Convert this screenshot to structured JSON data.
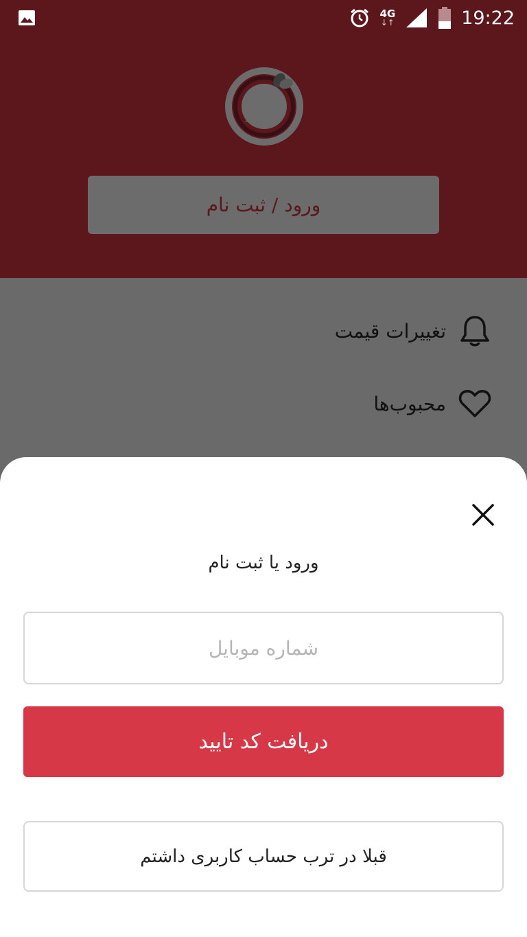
{
  "status_bar": {
    "time": "19:22",
    "network": "4G",
    "network_arrows": "↓↑"
  },
  "header": {
    "login_button_label": "ورود / ثبت نام"
  },
  "menu": {
    "items": [
      {
        "label": "تغییرات قیمت",
        "icon": "bell-icon"
      },
      {
        "label": "محبوب‌ها",
        "icon": "heart-icon"
      }
    ]
  },
  "sheet": {
    "title": "ورود یا ثبت نام",
    "mobile_placeholder": "شماره موبایل",
    "mobile_value": "",
    "confirm_label": "دریافت کد تایید",
    "account_label": "قبلا در ترب حساب کاربری داشتم"
  },
  "colors": {
    "header_bg": "#5c171d",
    "overlay_bg": "#6a6a6a",
    "primary": "#d63847",
    "sheet_bg": "#ffffff"
  }
}
